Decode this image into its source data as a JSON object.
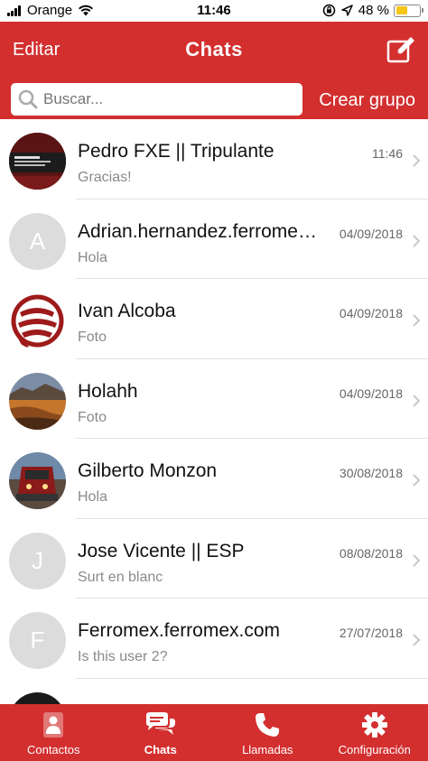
{
  "status_bar": {
    "carrier": "Orange",
    "time": "11:46",
    "battery": "48 %",
    "battery_level": 0.48
  },
  "header": {
    "edit_label": "Editar",
    "title": "Chats",
    "create_group_label": "Crear grupo"
  },
  "search": {
    "placeholder": "Buscar..."
  },
  "chats": [
    {
      "name": "Pedro FXE || Tripulante",
      "preview": "Gracias!",
      "time": "11:46",
      "avatar_type": "photo-banner"
    },
    {
      "name": "Adrian.hernandez.ferromex.com",
      "preview": "Hola",
      "time": "04/09/2018",
      "avatar_letter": "A"
    },
    {
      "name": "Ivan Alcoba",
      "preview": "Foto",
      "time": "04/09/2018",
      "avatar_type": "photo-logo"
    },
    {
      "name": "Holahh",
      "preview": "Foto",
      "time": "04/09/2018",
      "avatar_type": "photo-landscape"
    },
    {
      "name": "Gilberto Monzon",
      "preview": "Hola",
      "time": "30/08/2018",
      "avatar_type": "photo-train"
    },
    {
      "name": "Jose Vicente || ESP",
      "preview": "Surt en blanc",
      "time": "08/08/2018",
      "avatar_letter": "J"
    },
    {
      "name": "Ferromex.ferromex.com",
      "preview": "Is this user 2?",
      "time": "27/07/2018",
      "avatar_letter": "F"
    }
  ],
  "tabs": [
    {
      "label": "Contactos",
      "icon": "contact-icon"
    },
    {
      "label": "Chats",
      "icon": "chat-bubbles-icon",
      "active": true
    },
    {
      "label": "Llamadas",
      "icon": "phone-icon"
    },
    {
      "label": "Configuración",
      "icon": "gear-icon"
    }
  ],
  "colors": {
    "brand": "#d32f2f",
    "battery": "#f5c518"
  }
}
